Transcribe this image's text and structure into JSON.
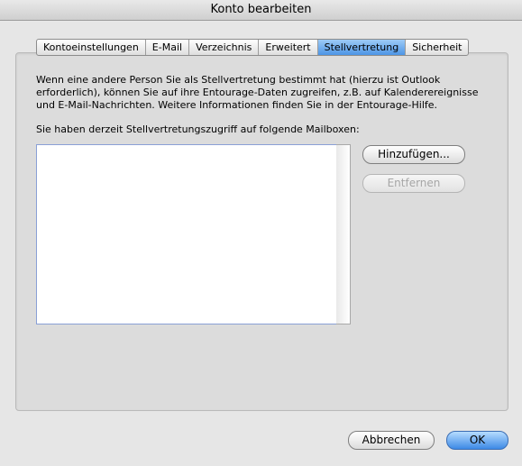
{
  "window": {
    "title": "Konto bearbeiten"
  },
  "tabs": [
    {
      "label": "Kontoeinstellungen",
      "active": false
    },
    {
      "label": "E-Mail",
      "active": false
    },
    {
      "label": "Verzeichnis",
      "active": false
    },
    {
      "label": "Erweitert",
      "active": false
    },
    {
      "label": "Stellvertretung",
      "active": true
    },
    {
      "label": "Sicherheit",
      "active": false
    }
  ],
  "content": {
    "description": "Wenn eine andere Person Sie als Stellvertretung bestimmt hat (hierzu ist Outlook erforderlich), können Sie auf ihre Entourage-Daten zugreifen, z.B. auf Kalenderereignisse und E-Mail-Nachrichten. Weitere Informationen finden Sie in der Entourage-Hilfe.",
    "mailbox_label": "Sie haben derzeit Stellvertretungszugriff auf folgende Mailboxen:",
    "mailboxes": []
  },
  "buttons": {
    "add": "Hinzufügen...",
    "remove": "Entfernen",
    "cancel": "Abbrechen",
    "ok": "OK"
  }
}
